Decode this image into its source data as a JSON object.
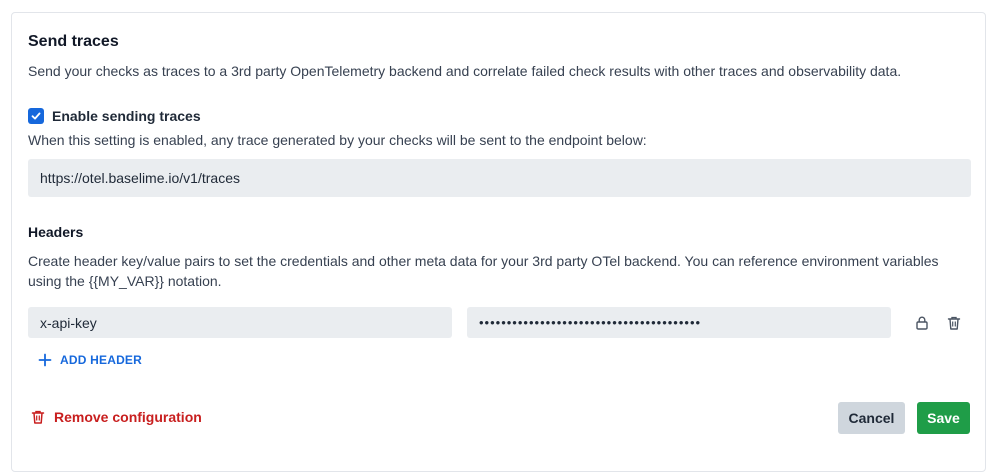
{
  "section": {
    "title": "Send traces",
    "description": "Send your checks as traces to a 3rd party OpenTelemetry backend and correlate failed check results with other traces and observability data."
  },
  "enable": {
    "label": "Enable sending traces",
    "checked": true,
    "hint": "When this setting is enabled, any trace generated by your checks will be sent to the endpoint below:"
  },
  "endpoint": {
    "value": "https://otel.baselime.io/v1/traces"
  },
  "headers": {
    "title": "Headers",
    "description": "Create header key/value pairs to set the credentials and other meta data for your 3rd party OTel backend. You can reference environment variables using the {{MY_VAR}} notation.",
    "rows": [
      {
        "key": "x-api-key",
        "value": "••••••••••••••••••••••••••••••••••••••••"
      }
    ],
    "add_label": "ADD HEADER",
    "row_icons": [
      "lock-icon",
      "trash-icon"
    ]
  },
  "footer": {
    "remove_label": "Remove configuration",
    "cancel_label": "Cancel",
    "save_label": "Save"
  },
  "colors": {
    "accent": "#1668dc",
    "danger": "#c81e1e",
    "save": "#1f9d48",
    "field_bg": "#eaedf0"
  }
}
